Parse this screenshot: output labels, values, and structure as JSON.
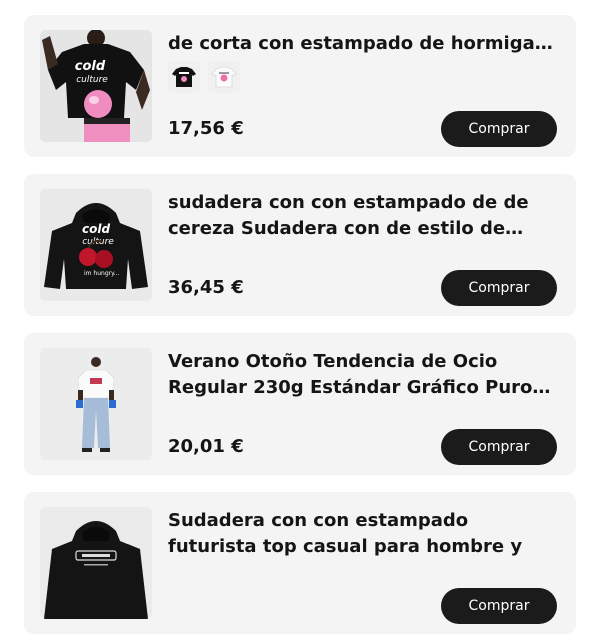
{
  "products": [
    {
      "title": "de corta con estampado de hormiga chile",
      "price": "17,56 €",
      "buy_label": "Comprar",
      "variant_count": 2
    },
    {
      "title": "sudadera con con estampado de de cereza Sudadera con de estilo de pareja",
      "price": "36,45 €",
      "buy_label": "Comprar"
    },
    {
      "title": "Verano Otoño Tendencia de Ocio Regular 230g Estándar Gráfico Puro Algodón",
      "price": "20,01 €",
      "buy_label": "Comprar"
    },
    {
      "title": "Sudadera con con estampado futurista top casual para hombre y",
      "price": "",
      "buy_label": "Comprar"
    }
  ],
  "thumb_text": {
    "brand_1": "cold",
    "brand_2": "culture",
    "tagline": "im hungry..."
  },
  "colors": {
    "card_bg": "#f4f4f4",
    "button_bg": "#1b1b1b",
    "button_text": "#ffffff",
    "text": "#151515"
  }
}
